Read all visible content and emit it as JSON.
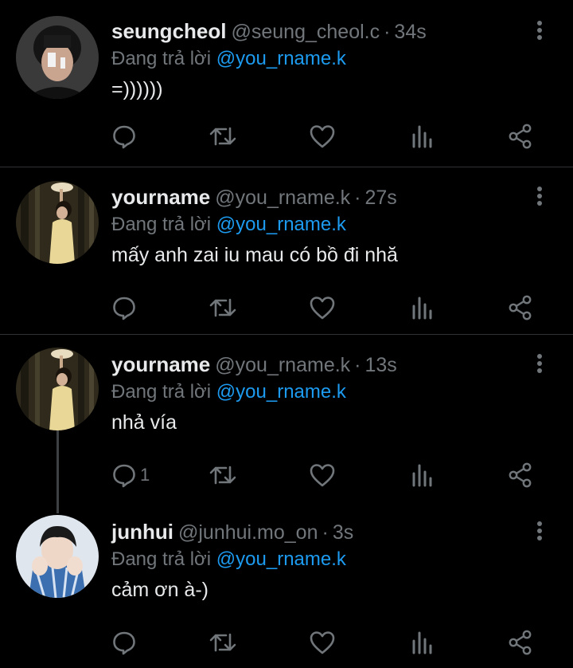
{
  "tweets": [
    {
      "name": "seungcheol",
      "handle": "@seung_cheol.c",
      "time": "34s",
      "reply_prefix": "Đang trả lời",
      "reply_to": "@you_rname.k",
      "text": "=))))))",
      "reply_count": ""
    },
    {
      "name": "yourname",
      "handle": "@you_rname.k",
      "time": "27s",
      "reply_prefix": "Đang trả lời",
      "reply_to": "@you_rname.k",
      "text": "mấy anh zai iu mau có bồ đi nhă",
      "reply_count": ""
    },
    {
      "name": "yourname",
      "handle": "@you_rname.k",
      "time": "13s",
      "reply_prefix": "Đang trả lời",
      "reply_to": "@you_rname.k",
      "text": "nhả vía",
      "reply_count": "1"
    },
    {
      "name": "junhui",
      "handle": "@junhui.mo_on",
      "time": "3s",
      "reply_prefix": "Đang trả lời",
      "reply_to": "@you_rname.k",
      "text": "cảm ơn à-)",
      "reply_count": ""
    }
  ],
  "separator": "·",
  "colors": {
    "background": "#000000",
    "text": "#e7e9ea",
    "muted": "#71767b",
    "accent": "#1d9bf0",
    "divider": "#2f3336"
  },
  "icons": [
    "more-icon",
    "reply-icon",
    "retweet-icon",
    "like-icon",
    "analytics-icon",
    "share-icon"
  ]
}
